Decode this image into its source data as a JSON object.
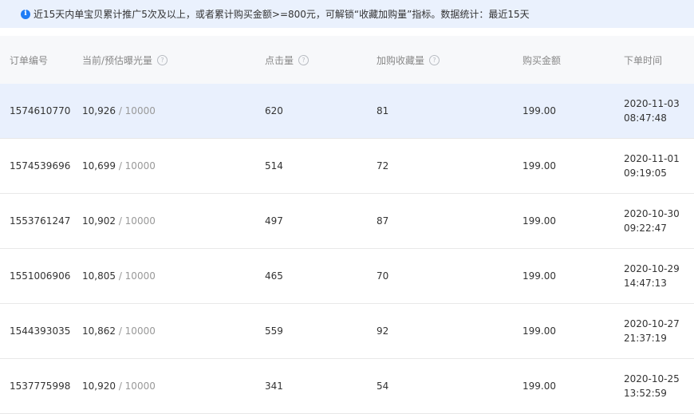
{
  "notice": {
    "icon": "info-icon",
    "text": "近15天内单宝贝累计推广5次及以上，或者累计购买金额>=800元，可解锁“收藏加购量”指标。数据统计：最近15天"
  },
  "table": {
    "headers": {
      "order_id": "订单编号",
      "exposure": "当前/预估曝光量",
      "clicks": "点击量",
      "favorites": "加购收藏量",
      "amount": "购买金额",
      "time": "下单时间"
    },
    "target_sep": " / ",
    "rows": [
      {
        "order_id": "1574610770",
        "exposure": "10,926",
        "target": "10000",
        "clicks": "620",
        "favorites": "81",
        "amount": "199.00",
        "date": "2020-11-03",
        "time": "08:47:48"
      },
      {
        "order_id": "1574539696",
        "exposure": "10,699",
        "target": "10000",
        "clicks": "514",
        "favorites": "72",
        "amount": "199.00",
        "date": "2020-11-01",
        "time": "09:19:05"
      },
      {
        "order_id": "1553761247",
        "exposure": "10,902",
        "target": "10000",
        "clicks": "497",
        "favorites": "87",
        "amount": "199.00",
        "date": "2020-10-30",
        "time": "09:22:47"
      },
      {
        "order_id": "1551006906",
        "exposure": "10,805",
        "target": "10000",
        "clicks": "465",
        "favorites": "70",
        "amount": "199.00",
        "date": "2020-10-29",
        "time": "14:47:13"
      },
      {
        "order_id": "1544393035",
        "exposure": "10,862",
        "target": "10000",
        "clicks": "559",
        "favorites": "92",
        "amount": "199.00",
        "date": "2020-10-27",
        "time": "21:37:19"
      },
      {
        "order_id": "1537775998",
        "exposure": "10,920",
        "target": "10000",
        "clicks": "341",
        "favorites": "54",
        "amount": "199.00",
        "date": "2020-10-25",
        "time": "13:52:59"
      }
    ]
  },
  "colors": {
    "notice_bg": "#eaf1fd",
    "info_icon": "#1f7cf5",
    "header_bg": "#f7f8fa",
    "highlight_row": "#e9f0fd"
  }
}
